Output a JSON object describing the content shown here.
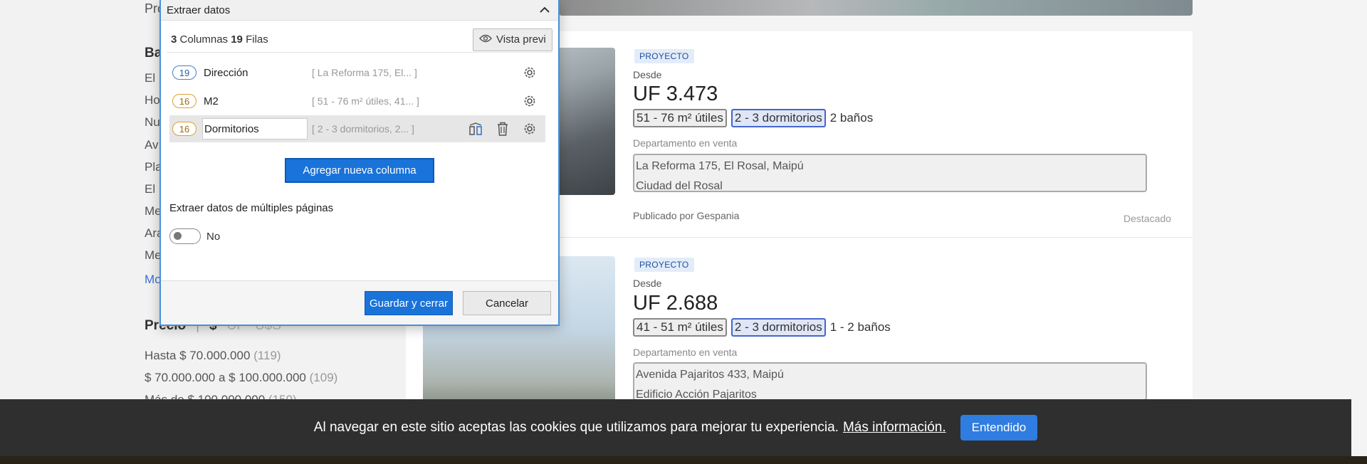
{
  "sidebar": {
    "top_partial": "Pro",
    "section_heading_partial": "Ba",
    "items_partial": [
      "El I",
      "Ho",
      "Nu",
      "Av",
      "Pla",
      "El I",
      "Me",
      "Ara",
      "Me"
    ],
    "more_link_partial": "Mo",
    "price": {
      "heading": "Precio",
      "separator": "|",
      "currencies": [
        "$",
        "UF",
        "U$S"
      ],
      "options": [
        {
          "label": "Hasta $ 70.000.000",
          "count": "(119)"
        },
        {
          "label": "$ 70.000.000 a $ 100.000.000",
          "count": "(109)"
        },
        {
          "label": "Más de $ 100.000.000",
          "count": "(150)"
        }
      ]
    }
  },
  "dialog": {
    "title": "Extraer datos",
    "summary": {
      "columns_count": "3",
      "columns_label": "Columnas",
      "rows_count": "19",
      "rows_label": "Filas"
    },
    "preview_label": "Vista previ",
    "columns": [
      {
        "count": "19",
        "name": "Dirección",
        "preview": "[ La Reforma 175, El...  ]"
      },
      {
        "count": "16",
        "name": "M2",
        "preview": "[ 51 - 76 m² útiles, 41...  ]"
      },
      {
        "count": "16",
        "name": "Dormitorios",
        "preview": "[ 2 - 3 dormitorios, 2...  ]"
      }
    ],
    "add_column_label": "Agregar nueva columna",
    "multi_pages_label": "Extraer datos de múltiples páginas",
    "toggle_state": "No",
    "save_label": "Guardar y cerrar",
    "cancel_label": "Cancelar"
  },
  "listings": [
    {
      "badge": "PROYECTO",
      "from_label": "Desde",
      "price": "UF 3.473",
      "area": "51 - 76 m² útiles",
      "bedrooms": "2 - 3 dormitorios",
      "baths": "2 baños",
      "type": "Departamento en venta",
      "address_line1": "La Reforma 175, El Rosal, Maipú",
      "address_line2": "Ciudad del Rosal",
      "published_by": "Publicado por Gespania",
      "featured": "Destacado"
    },
    {
      "badge": "PROYECTO",
      "from_label": "Desde",
      "price": "UF 2.688",
      "area": "41 - 51 m² útiles",
      "bedrooms": "2 - 3 dormitorios",
      "baths": "1 - 2 baños",
      "type": "Departamento en venta",
      "address_line1": "Avenida Pajaritos 433, Maipú",
      "address_line2": "Edificio Acción Pajaritos"
    }
  ],
  "cookie": {
    "text": "Al navegar en este sitio aceptas las cookies que utilizamos para mejorar tu experiencia.",
    "link": "Más información.",
    "button": "Entendido"
  },
  "colors": {
    "accent": "#1a73d9",
    "dialog_border": "#4a8fd8",
    "cookie_bg": "#2f2f2f",
    "badge_bg": "#e3ecf9"
  }
}
